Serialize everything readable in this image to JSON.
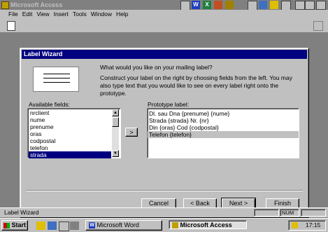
{
  "app": {
    "title": "Microsoft Access"
  },
  "menu": [
    "File",
    "Edit",
    "View",
    "Insert",
    "Tools",
    "Window",
    "Help"
  ],
  "dialog": {
    "title": "Label Wizard",
    "question": "What would you like on your mailing label?",
    "instructions": "Construct your label on the right by choosing fields from the left. You may also type text that you would like to see on every label right onto the prototype.",
    "available_label": "Available fields:",
    "prototype_label": "Prototype label:",
    "available_fields": [
      "nrclient",
      "nume",
      "prenume",
      "oras",
      "codpostal",
      "telefon",
      "strada"
    ],
    "selected_field": "strada",
    "prototype_lines": [
      "Dl. sau Dna {prenume} {nume}",
      "Strada {strada} Nr. {nr}",
      "Din {oras} Cod {codpostal}",
      "Telefon {telefon}"
    ],
    "add_button": ">",
    "buttons": {
      "cancel": "Cancel",
      "back": "< Back",
      "next": "Next >",
      "finish": "Finish"
    }
  },
  "status": {
    "left": "Label Wizard",
    "num": "NUM"
  },
  "taskbar": {
    "start": "Start",
    "word": "Microsoft Word",
    "access": "Microsoft Access",
    "clock": "17:15"
  }
}
